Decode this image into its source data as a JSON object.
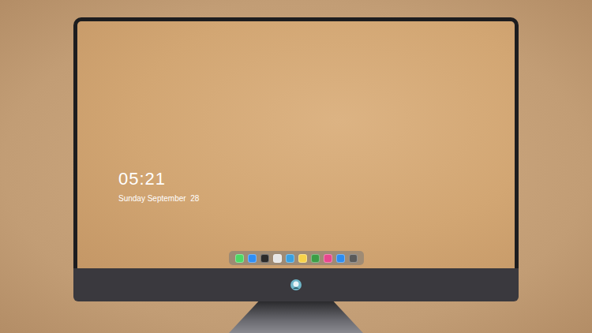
{
  "lock_screen": {
    "time": "05:21",
    "date": "Sunday September  28"
  },
  "dock": {
    "items": [
      {
        "color": "#4cd964"
      },
      {
        "color": "#2f8ef5"
      },
      {
        "color": "#2b2b2b"
      },
      {
        "color": "#e6e6e6"
      },
      {
        "color": "#3aa0e0"
      },
      {
        "color": "#f7d34a"
      },
      {
        "color": "#3c9d46"
      },
      {
        "color": "#e8468e"
      },
      {
        "color": "#2d8cf0"
      },
      {
        "color": "#5a5a5a"
      }
    ]
  }
}
